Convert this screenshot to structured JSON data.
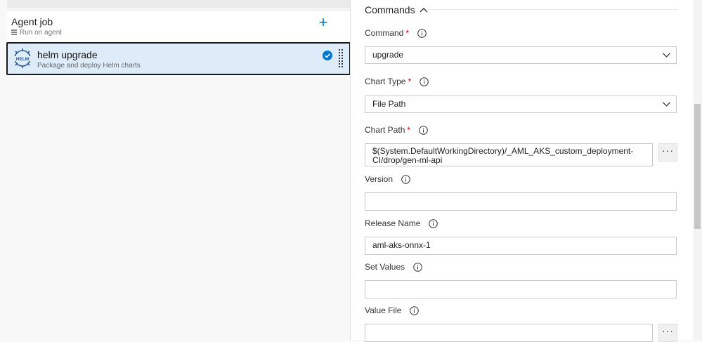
{
  "left": {
    "agent_job": {
      "title": "Agent job",
      "subtitle": "Run on agent",
      "add_symbol": "+"
    },
    "task": {
      "title": "helm upgrade",
      "subtitle": "Package and deploy Helm charts",
      "logo_text": "HELM"
    }
  },
  "right": {
    "section_title": "Commands",
    "command": {
      "label": "Command",
      "required": "*",
      "value": "upgrade"
    },
    "chart_type": {
      "label": "Chart Type",
      "required": "*",
      "value": "File Path"
    },
    "chart_path": {
      "label": "Chart Path",
      "required": "*",
      "value": "$(System.DefaultWorkingDirectory)/_AML_AKS_custom_deployment-CI/drop/gen-ml-api"
    },
    "version": {
      "label": "Version",
      "value": ""
    },
    "release_name": {
      "label": "Release Name",
      "value": "aml-aks-onnx-1"
    },
    "set_values": {
      "label": "Set Values",
      "value": ""
    },
    "value_file": {
      "label": "Value File",
      "value": ""
    },
    "ellipsis": "···"
  },
  "colors": {
    "accent": "#0078d4",
    "selected_bg": "#deecf9",
    "required": "#cc0000"
  },
  "icons": [
    "server-icon",
    "plus-icon",
    "helm-icon",
    "check-circle-icon",
    "drag-handle-icon",
    "chevron-up-icon",
    "info-icon",
    "chevron-down-icon"
  ]
}
